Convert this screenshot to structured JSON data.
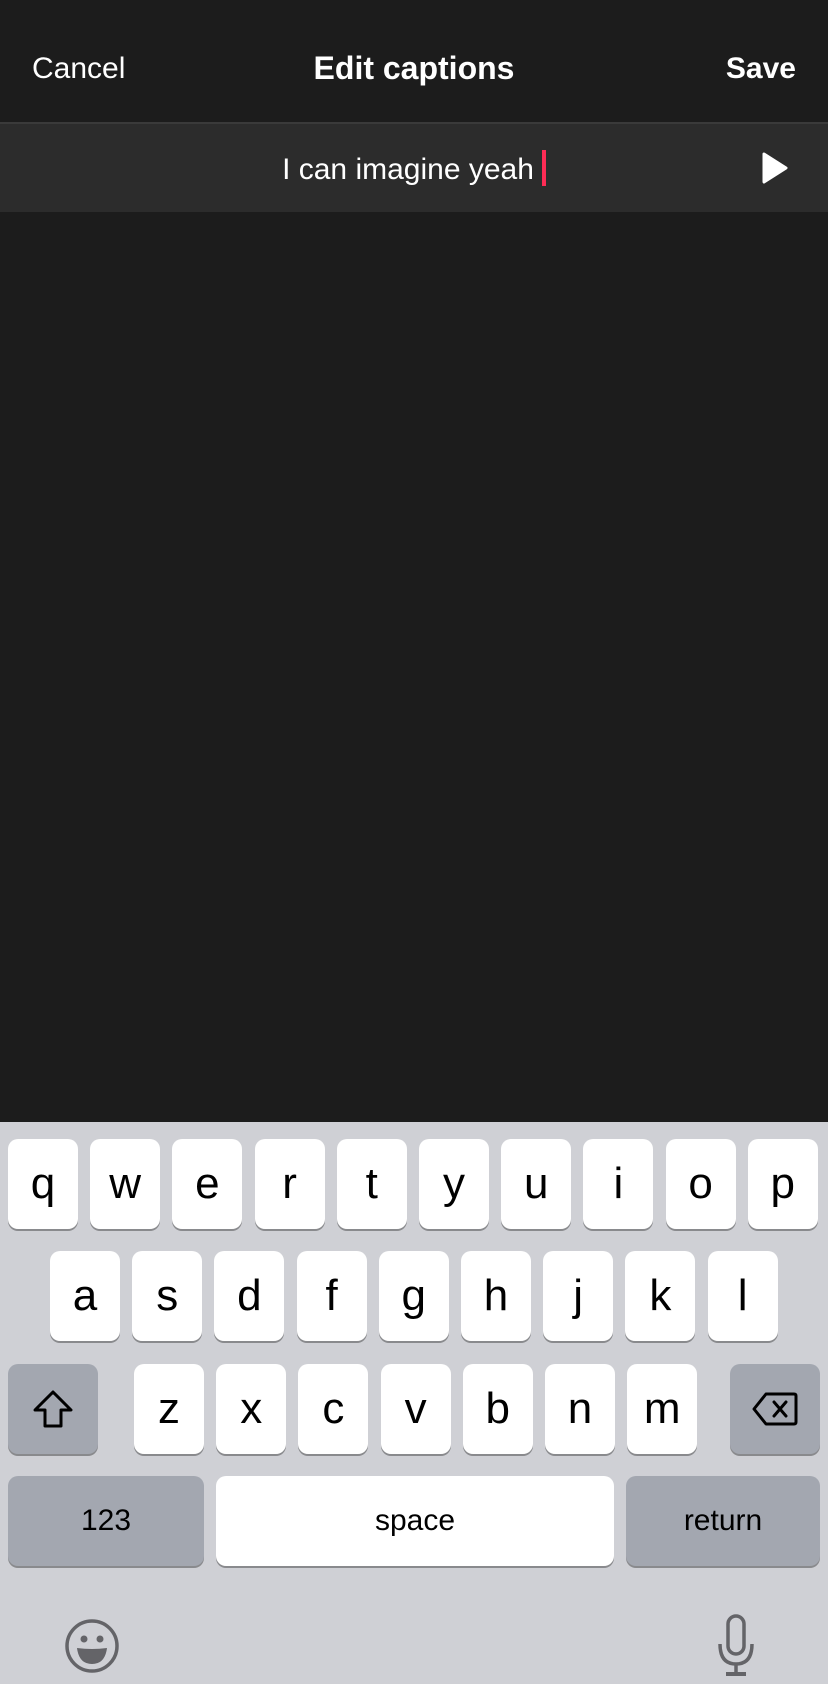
{
  "navbar": {
    "cancel_label": "Cancel",
    "title": "Edit captions",
    "save_label": "Save"
  },
  "caption": {
    "text": "I can imagine yeah",
    "caret_color": "#fe2c55"
  },
  "keyboard": {
    "row1": [
      "q",
      "w",
      "e",
      "r",
      "t",
      "y",
      "u",
      "i",
      "o",
      "p"
    ],
    "row2": [
      "a",
      "s",
      "d",
      "f",
      "g",
      "h",
      "j",
      "k",
      "l"
    ],
    "row3": [
      "z",
      "x",
      "c",
      "v",
      "b",
      "n",
      "m"
    ],
    "numbers_label": "123",
    "space_label": "space",
    "return_label": "return",
    "shift_icon": "shift-arrow-icon",
    "delete_icon": "backspace-icon",
    "emoji_icon": "emoji-smile-icon",
    "mic_icon": "microphone-icon"
  }
}
